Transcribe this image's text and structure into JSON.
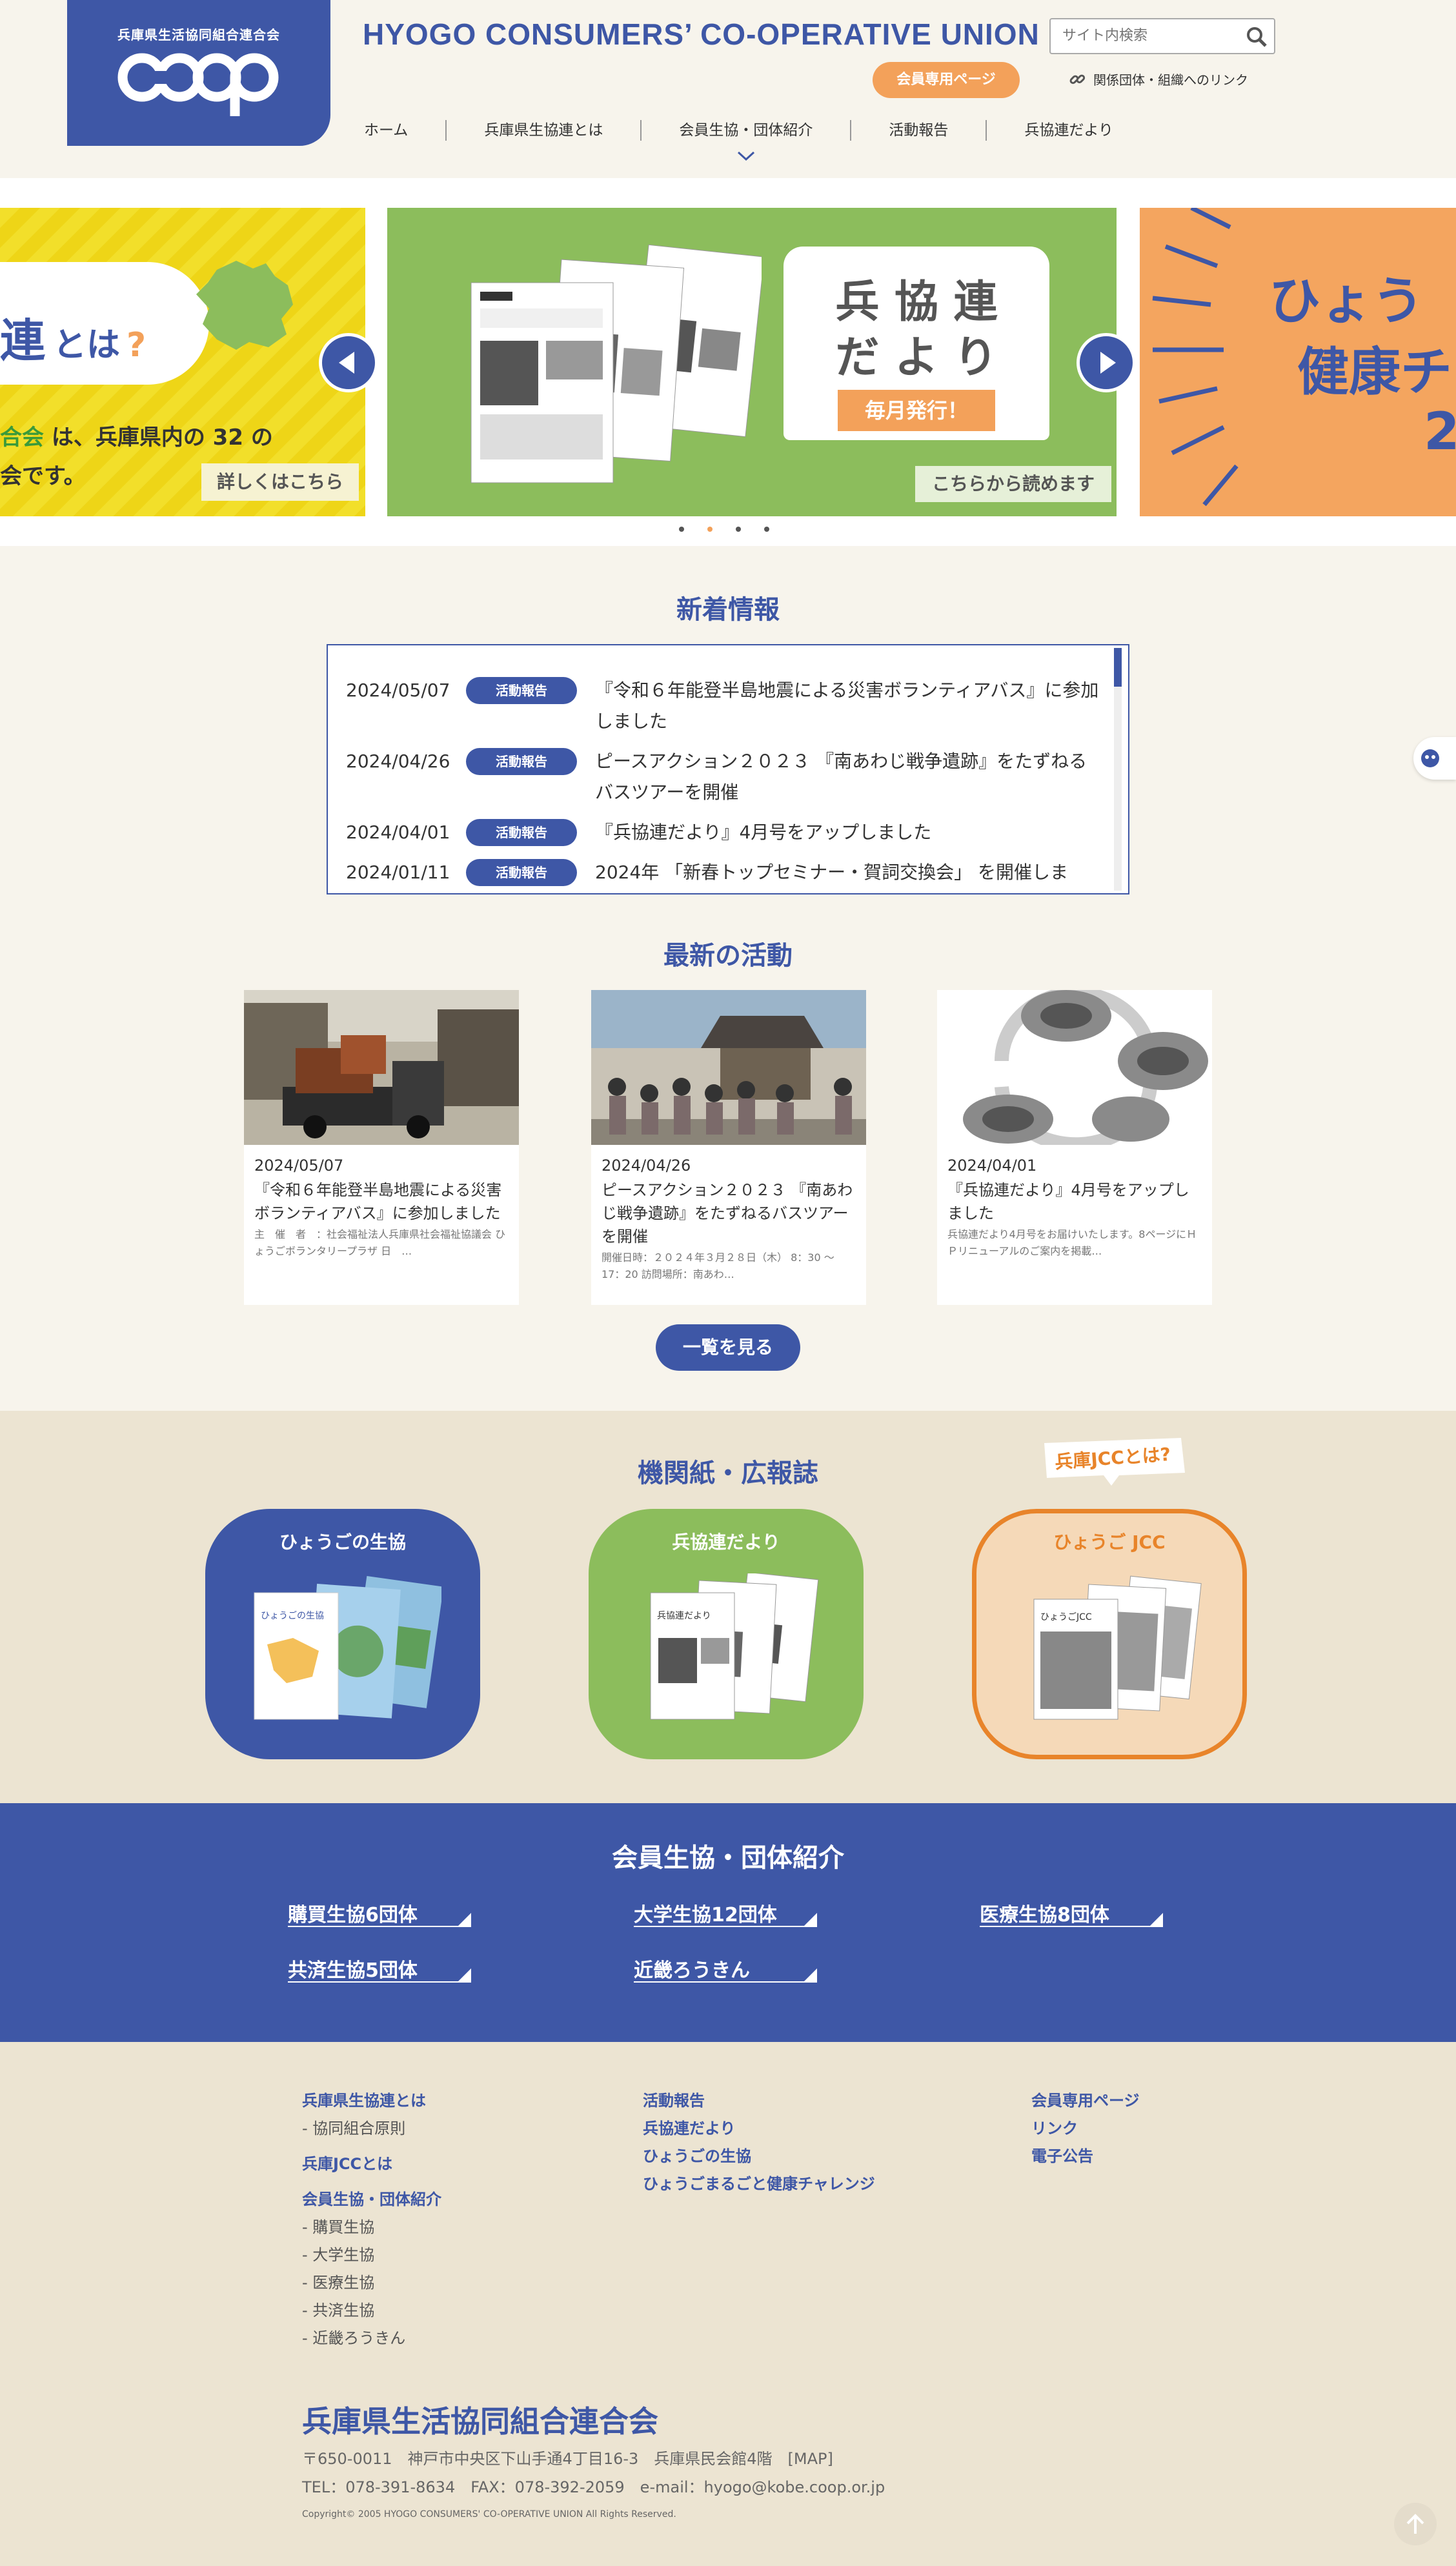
{
  "header": {
    "logo_small": "兵庫県生活協同組合連合会",
    "site_name_en": "HYOGO CONSUMERS’ CO-OPERATIVE UNION",
    "search_placeholder": "サイト内検索",
    "member_button": "会員専用ページ",
    "related_link": "関係団体・組織へのリンク",
    "nav": [
      "ホーム",
      "兵庫県生協連とは",
      "会員生協・団体紹介",
      "活動報告",
      "兵協連だより"
    ]
  },
  "slider": {
    "left": {
      "title_part": "連",
      "title_rest": "とは",
      "q": "?",
      "line1_green": "合会",
      "line1": " は、兵庫県内の 32 の",
      "line2": "会です。",
      "button": "詳しくはこちら"
    },
    "center": {
      "title1": "兵 協 連",
      "title2": "だ よ り",
      "ribbon": "毎月発行！",
      "button": "こちらから読めます"
    },
    "right": {
      "line1": "ひょう",
      "line2": "健康チ",
      "line3": "2"
    }
  },
  "news": {
    "title": "新着情報",
    "items": [
      {
        "date": "2024/05/07",
        "badge": "活動報告",
        "title": "『令和６年能登半島地震による災害ボランティアバス』に参加しました"
      },
      {
        "date": "2024/04/26",
        "badge": "活動報告",
        "title": "ピースアクション２０２３ 『南あわじ戦争遺跡』をたずねるバスツアーを開催"
      },
      {
        "date": "2024/04/01",
        "badge": "活動報告",
        "title": "『兵協連だより』4月号をアップしました"
      },
      {
        "date": "2024/01/11",
        "badge": "活動報告",
        "title": "2024年 「新春トップセミナー・賀詞交換会」 を開催しま"
      }
    ]
  },
  "activities": {
    "title": "最新の活動",
    "cards": [
      {
        "date": "2024/05/07",
        "title": "『令和６年能登半島地震による災害ボランティアバス』に参加しました",
        "desc": "主　催　者　：社会福祉法人兵庫県社会福祉協議会 ひょうごボランタリープラザ 日　…"
      },
      {
        "date": "2024/04/26",
        "title": "ピースアクション２０２３ 『南あわじ戦争遺跡』をたずねるバスツアーを開催",
        "desc": "開催日時：２０２４年３月２８日（木） 8：30 〜 17：20 訪問場所：南あわ…"
      },
      {
        "date": "2024/04/01",
        "title": "『兵協連だより』4月号をアップしました",
        "desc": "兵協連だより4月号をお届けいたします。8ページにＨＰリニューアルのご案内を掲載…"
      }
    ],
    "list_button": "一覧を見る"
  },
  "publications": {
    "title": "機関紙・広報誌",
    "jcc_tag": "兵庫JCCとは?",
    "items": [
      {
        "label": "ひょうごの生協",
        "cover": "ひょうごの生協"
      },
      {
        "label": "兵協連だより",
        "cover": "兵協連だより"
      },
      {
        "label": "ひょうご JCC",
        "cover": "ひょうごJCC"
      }
    ]
  },
  "groups": {
    "title": "会員生協・団体紹介",
    "items": [
      "購買生協6団体",
      "大学生協12団体",
      "医療生協8団体",
      "共済生協5団体",
      "近畿ろうきん"
    ]
  },
  "footer": {
    "col1": [
      {
        "text": "兵庫県生協連とは",
        "kind": "link"
      },
      {
        "text": "- 協同組合原則",
        "kind": "sub"
      },
      {
        "text": "兵庫JCCとは",
        "kind": "link"
      },
      {
        "text": "会員生協・団体紹介",
        "kind": "link"
      },
      {
        "text": "- 購買生協",
        "kind": "sub"
      },
      {
        "text": "- 大学生協",
        "kind": "sub"
      },
      {
        "text": "- 医療生協",
        "kind": "sub"
      },
      {
        "text": "- 共済生協",
        "kind": "sub"
      },
      {
        "text": "- 近畿ろうきん",
        "kind": "sub"
      }
    ],
    "col2": [
      "活動報告",
      "兵協連だより",
      "ひょうごの生協",
      "ひょうごまるごと健康チャレンジ"
    ],
    "col3": [
      "会員専用ページ",
      "リンク",
      "電子公告"
    ],
    "org_name": "兵庫県生活協同組合連合会",
    "address": "〒650-0011　神戸市中央区下山手通4丁目16-3　兵庫県民会館4階　[MAP]",
    "tel": "TEL：078-391-8634　FAX：078-392-2059　e-mail：hyogo@kobe.coop.or.jp",
    "copyright": "Copyright© 2005 HYOGO CONSUMERS' CO-OPERATIVE UNION All Rights Reserved."
  },
  "colors": {
    "brand_blue": "#3e57a6",
    "accent_orange": "#f3a15a",
    "green": "#8cbd5c",
    "beige": "#ece4d2"
  }
}
